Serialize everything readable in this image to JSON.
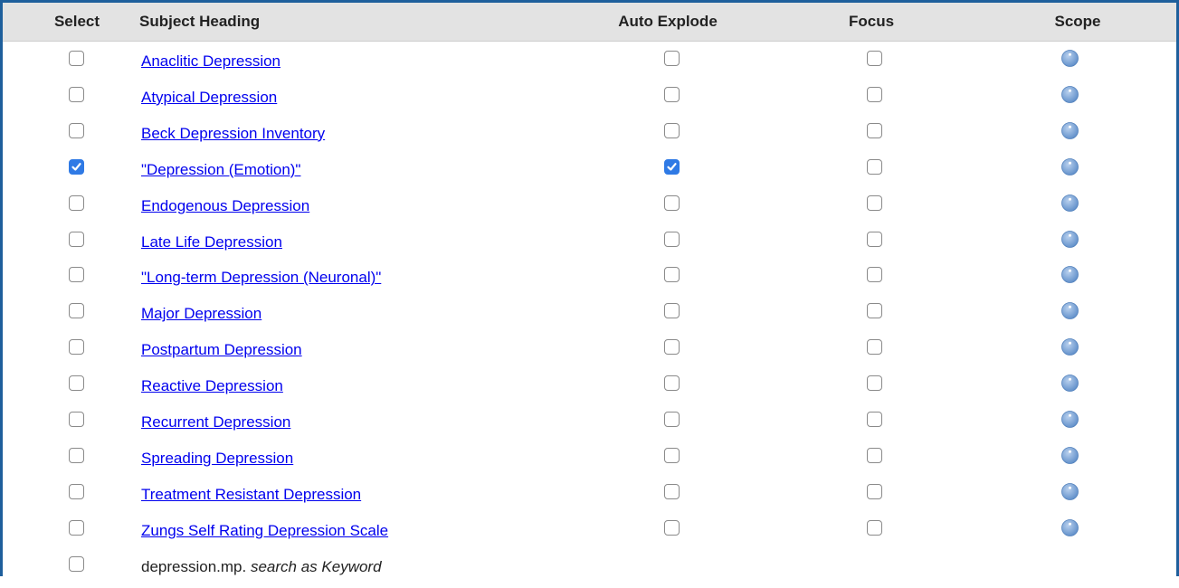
{
  "header": {
    "select": "Select",
    "subject": "Subject Heading",
    "auto_explode": "Auto Explode",
    "focus": "Focus",
    "scope": "Scope"
  },
  "rows": [
    {
      "label": "Anaclitic Depression",
      "select": false,
      "auto_explode": false,
      "focus": false
    },
    {
      "label": "Atypical Depression",
      "select": false,
      "auto_explode": false,
      "focus": false
    },
    {
      "label": "Beck Depression Inventory",
      "select": false,
      "auto_explode": false,
      "focus": false
    },
    {
      "label": "\"Depression (Emotion)\"",
      "select": true,
      "auto_explode": true,
      "focus": false
    },
    {
      "label": "Endogenous Depression",
      "select": false,
      "auto_explode": false,
      "focus": false
    },
    {
      "label": "Late Life Depression",
      "select": false,
      "auto_explode": false,
      "focus": false
    },
    {
      "label": "\"Long-term Depression (Neuronal)\"",
      "select": false,
      "auto_explode": false,
      "focus": false
    },
    {
      "label": "Major Depression",
      "select": false,
      "auto_explode": false,
      "focus": false
    },
    {
      "label": "Postpartum Depression",
      "select": false,
      "auto_explode": false,
      "focus": false
    },
    {
      "label": "Reactive Depression",
      "select": false,
      "auto_explode": false,
      "focus": false
    },
    {
      "label": "Recurrent Depression",
      "select": false,
      "auto_explode": false,
      "focus": false
    },
    {
      "label": "Spreading Depression",
      "select": false,
      "auto_explode": false,
      "focus": false
    },
    {
      "label": "Treatment Resistant Depression",
      "select": false,
      "auto_explode": false,
      "focus": false
    },
    {
      "label": "Zungs Self Rating Depression Scale",
      "select": false,
      "auto_explode": false,
      "focus": false
    }
  ],
  "keyword_row": {
    "term": "depression.mp.",
    "suffix": "search as Keyword",
    "select": false
  },
  "colors": {
    "frame_border": "#1e5f9c",
    "header_bg": "#e3e3e3",
    "link": "#0000ee",
    "checkbox_checked": "#2f7ae5",
    "info_icon": "#7aa7d8"
  },
  "icons": {
    "scope": "info-circle-icon"
  }
}
